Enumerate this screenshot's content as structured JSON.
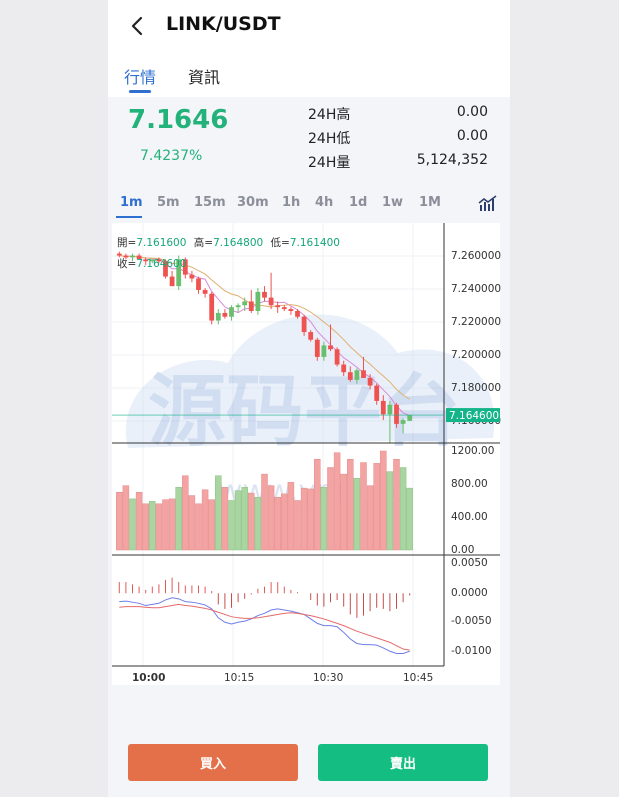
{
  "header": {
    "title": "LINK/USDT",
    "back_icon": "chevron-left-icon"
  },
  "tabs": [
    {
      "label": "行情",
      "active": true
    },
    {
      "label": "資訊",
      "active": false
    }
  ],
  "summary": {
    "price": "7.1646",
    "change_pct": "7.4237%",
    "stats": [
      {
        "label": "24H高",
        "value": "0.00"
      },
      {
        "label": "24H低",
        "value": "0.00"
      },
      {
        "label": "24H量",
        "value": "5,124,352"
      }
    ],
    "up_color": "#23b27a"
  },
  "intervals": [
    "1m",
    "5m",
    "15m",
    "30m",
    "1h",
    "4h",
    "1d",
    "1w",
    "1M"
  ],
  "active_interval": "1m",
  "indicator_icon": "chart-indicator-icon",
  "chart": {
    "ohlc_open_label": "開=",
    "ohlc_open": "7.161600",
    "ohlc_high_label": "高=",
    "ohlc_high": "7.164800",
    "ohlc_low_label": "低=",
    "ohlc_low": "7.161400",
    "ohlc_close_label": "收=",
    "ohlc_close": "7.164600",
    "current_price_tag": "7.164600",
    "price_ticks": [
      "7.260000",
      "7.240000",
      "7.220000",
      "7.200000",
      "7.180000",
      "7.160000"
    ],
    "volume_ticks": [
      "1200.00",
      "800.00",
      "400.00",
      "0.00"
    ],
    "macd_ticks": [
      "0.0050",
      "0.0000",
      "-0.0050",
      "-0.0100"
    ],
    "time_ticks": [
      "10:00",
      "10:15",
      "10:30",
      "10:45"
    ],
    "watermark": "源码平台",
    "watermark_url": "www.ymp.cc",
    "colors": {
      "up": "#6abf6e",
      "down": "#ef5350",
      "up_vol": "#a8d5a0",
      "down_vol": "#f4a3a3",
      "price_tag": "#14b48a"
    }
  },
  "chart_data": {
    "type": "candlestick",
    "price_ylim": [
      7.15,
      7.265
    ],
    "candles": [
      [
        7.249,
        7.25,
        7.247,
        7.248
      ],
      [
        7.248,
        7.249,
        7.246,
        7.247
      ],
      [
        7.247,
        7.249,
        7.245,
        7.248
      ],
      [
        7.248,
        7.249,
        7.246,
        7.246
      ],
      [
        7.246,
        7.247,
        7.243,
        7.245
      ],
      [
        7.245,
        7.246,
        7.244,
        7.246
      ],
      [
        7.246,
        7.247,
        7.244,
        7.245
      ],
      [
        7.245,
        7.246,
        7.236,
        7.237
      ],
      [
        7.237,
        7.24,
        7.233,
        7.232
      ],
      [
        7.232,
        7.248,
        7.23,
        7.246
      ],
      [
        7.246,
        7.247,
        7.236,
        7.238
      ],
      [
        7.238,
        7.24,
        7.234,
        7.236
      ],
      [
        7.236,
        7.237,
        7.228,
        7.23
      ],
      [
        7.23,
        7.231,
        7.226,
        7.228
      ],
      [
        7.228,
        7.229,
        7.212,
        7.214
      ],
      [
        7.214,
        7.22,
        7.212,
        7.218
      ],
      [
        7.218,
        7.22,
        7.215,
        7.216
      ],
      [
        7.216,
        7.222,
        7.214,
        7.221
      ],
      [
        7.221,
        7.223,
        7.218,
        7.222
      ],
      [
        7.222,
        7.226,
        7.219,
        7.224
      ],
      [
        7.224,
        7.23,
        7.218,
        7.219
      ],
      [
        7.219,
        7.231,
        7.217,
        7.229
      ],
      [
        7.229,
        7.232,
        7.224,
        7.226
      ],
      [
        7.226,
        7.239,
        7.22,
        7.222
      ],
      [
        7.222,
        7.224,
        7.218,
        7.221
      ],
      [
        7.221,
        7.222,
        7.219,
        7.22
      ],
      [
        7.22,
        7.221,
        7.217,
        7.219
      ],
      [
        7.219,
        7.22,
        7.215,
        7.216
      ],
      [
        7.216,
        7.217,
        7.206,
        7.208
      ],
      [
        7.208,
        7.209,
        7.203,
        7.204
      ],
      [
        7.204,
        7.205,
        7.193,
        7.195
      ],
      [
        7.195,
        7.203,
        7.193,
        7.201
      ],
      [
        7.201,
        7.212,
        7.198,
        7.199
      ],
      [
        7.199,
        7.2,
        7.19,
        7.191
      ],
      [
        7.191,
        7.193,
        7.185,
        7.187
      ],
      [
        7.187,
        7.19,
        7.182,
        7.183
      ],
      [
        7.183,
        7.189,
        7.181,
        7.188
      ],
      [
        7.188,
        7.195,
        7.186,
        7.184
      ],
      [
        7.184,
        7.186,
        7.178,
        7.18
      ],
      [
        7.18,
        7.181,
        7.17,
        7.172
      ],
      [
        7.172,
        7.175,
        7.162,
        7.165
      ],
      [
        7.165,
        7.172,
        7.15,
        7.17
      ],
      [
        7.17,
        7.171,
        7.158,
        7.16
      ],
      [
        7.16,
        7.163,
        7.155,
        7.162
      ],
      [
        7.1616,
        7.1648,
        7.1614,
        7.1646
      ]
    ],
    "volumes": [
      700,
      780,
      620,
      700,
      560,
      590,
      560,
      610,
      620,
      760,
      900,
      660,
      560,
      730,
      610,
      900,
      760,
      600,
      720,
      760,
      690,
      640,
      920,
      780,
      640,
      680,
      820,
      600,
      750,
      740,
      1100,
      760,
      1000,
      1180,
      920,
      1100,
      870,
      1060,
      780,
      1050,
      1200,
      950,
      1100,
      1000,
      750
    ],
    "macd_ylim": [
      -0.0125,
      0.0065
    ],
    "dif": [
      -0.0015,
      -0.0014,
      -0.0016,
      -0.0018,
      -0.0022,
      -0.002,
      -0.0018,
      -0.0012,
      -0.0008,
      -0.001,
      -0.0015,
      -0.0016,
      -0.0018,
      -0.0021,
      -0.0028,
      -0.0044,
      -0.0052,
      -0.0055,
      -0.0052,
      -0.005,
      -0.0046,
      -0.004,
      -0.0036,
      -0.003,
      -0.0028,
      -0.003,
      -0.0032,
      -0.0035,
      -0.0038,
      -0.0046,
      -0.0054,
      -0.0058,
      -0.0058,
      -0.006,
      -0.007,
      -0.0082,
      -0.009,
      -0.0092,
      -0.0092,
      -0.0093,
      -0.0098,
      -0.0104,
      -0.0108,
      -0.0108,
      -0.0104
    ],
    "dea": [
      -0.0025,
      -0.0024,
      -0.0024,
      -0.0024,
      -0.0025,
      -0.0026,
      -0.0026,
      -0.0024,
      -0.0022,
      -0.002,
      -0.0022,
      -0.0023,
      -0.0025,
      -0.0027,
      -0.003,
      -0.0034,
      -0.0038,
      -0.0042,
      -0.0044,
      -0.0045,
      -0.0045,
      -0.0044,
      -0.0042,
      -0.004,
      -0.0038,
      -0.0036,
      -0.0035,
      -0.0036,
      -0.0038,
      -0.004,
      -0.0043,
      -0.0046,
      -0.005,
      -0.0054,
      -0.0058,
      -0.0063,
      -0.0068,
      -0.0072,
      -0.0076,
      -0.008,
      -0.0084,
      -0.0088,
      -0.0094,
      -0.01,
      -0.0102
    ],
    "macd": [
      0.002,
      0.002,
      0.0016,
      0.0012,
      0.0006,
      0.0012,
      0.0016,
      0.0024,
      0.0028,
      0.002,
      0.0014,
      0.0014,
      0.0014,
      0.0012,
      0.0004,
      -0.002,
      -0.0028,
      -0.0026,
      -0.0016,
      -0.001,
      -0.0002,
      0.0008,
      0.0012,
      0.002,
      0.002,
      0.0012,
      0.0006,
      0.0002,
      0.0,
      -0.0012,
      -0.0022,
      -0.0024,
      -0.0016,
      -0.0012,
      -0.0024,
      -0.0038,
      -0.0044,
      -0.004,
      -0.0032,
      -0.0026,
      -0.0028,
      -0.0032,
      -0.0028,
      -0.0016,
      -0.0004
    ]
  }
}
